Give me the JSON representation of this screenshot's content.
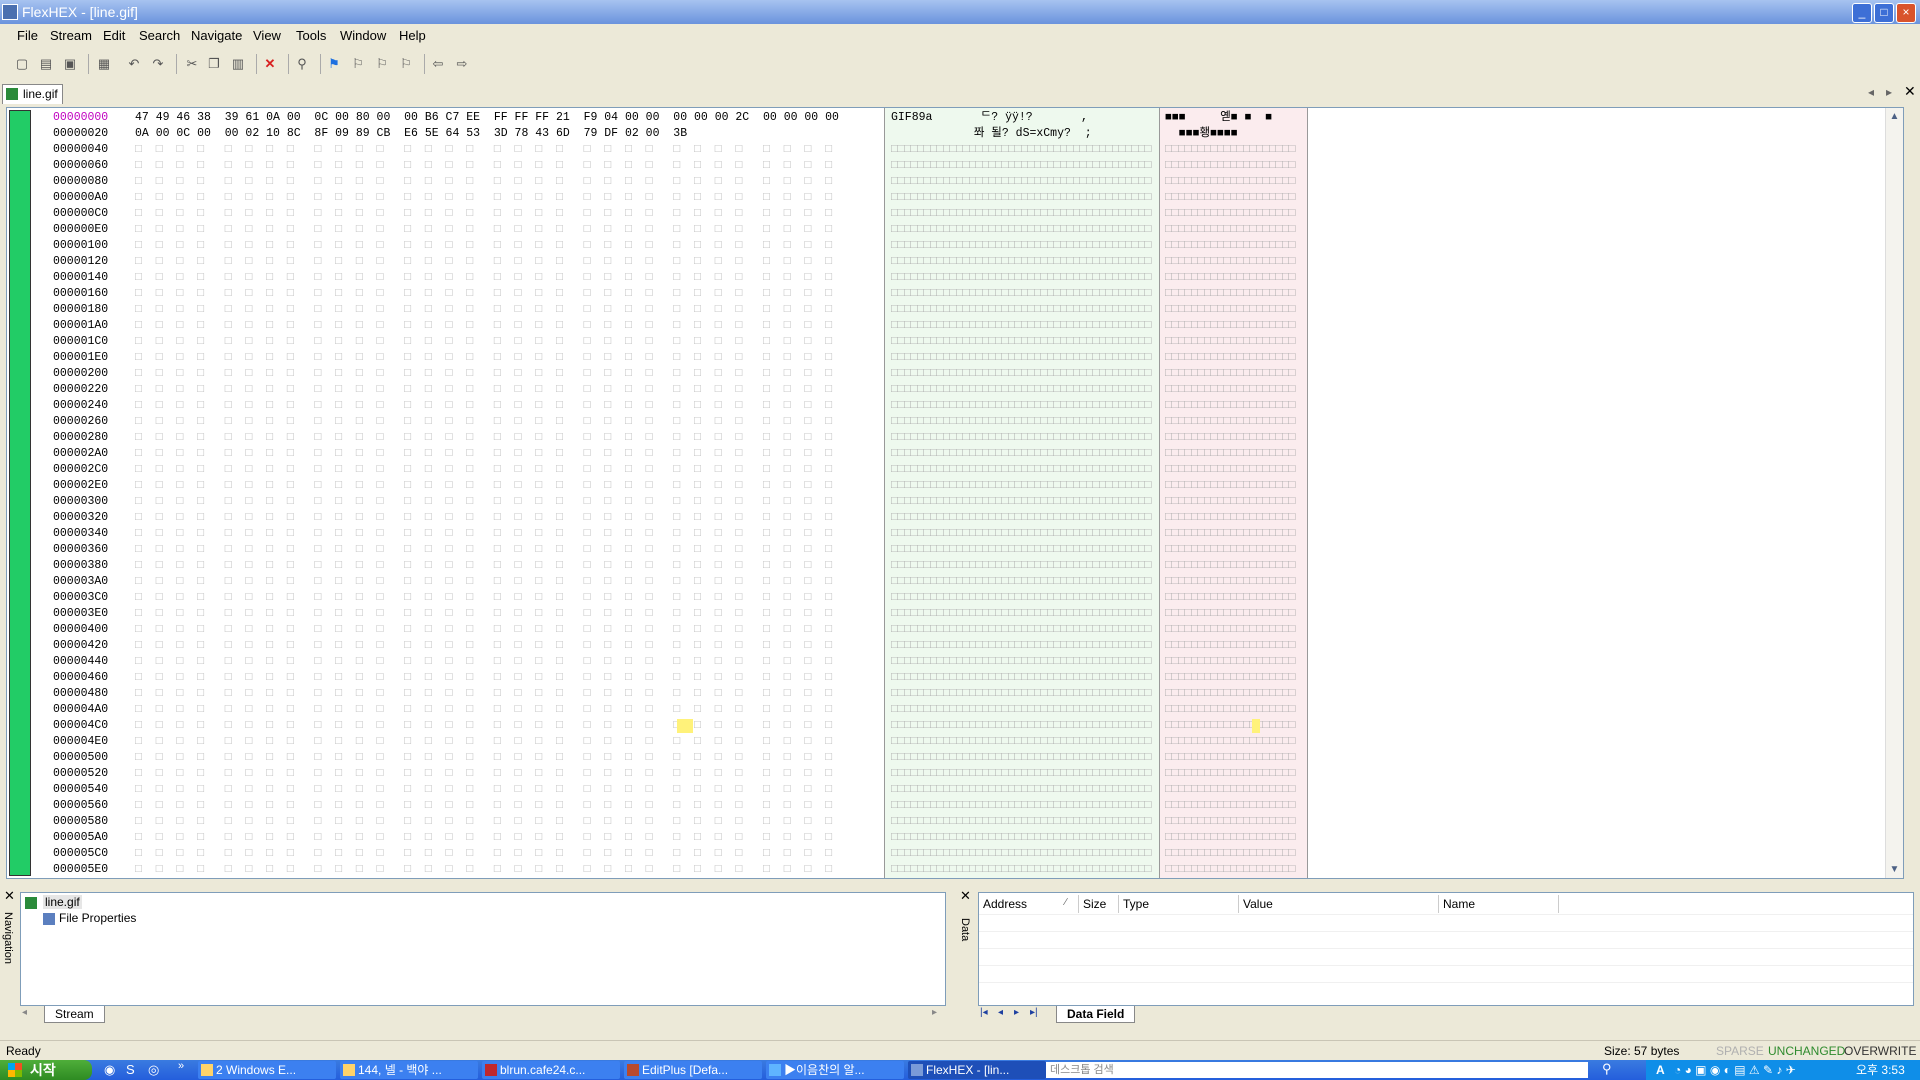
{
  "window": {
    "title": "FlexHEX - [line.gif]",
    "controls": [
      "_",
      "□",
      "×"
    ]
  },
  "menu": [
    "File",
    "Stream",
    "Edit",
    "Search",
    "Navigate",
    "View",
    "Tools",
    "Window",
    "Help"
  ],
  "toolbar": {
    "icons": [
      "new-icon",
      "open-icon",
      "save-icon",
      "print-icon",
      "undo-icon",
      "redo-icon",
      "cut-icon",
      "copy-icon",
      "paste-icon",
      "delete-icon",
      "find-icon",
      "bookmark-icon",
      "bookmark-next-icon",
      "bookmark-prev-icon",
      "bookmark-clear-icon",
      "back-icon",
      "forward-icon"
    ]
  },
  "doc_tab": {
    "label": "line.gif"
  },
  "hex": {
    "rows": [
      {
        "addr": "00000000",
        "hex": "47 49 46 38  39 61 0A 00  0C 00 80 00  00 B6 C7 EE  FF FF FF 21  F9 04 00 00  00 00 00 2C  00 00 00 00",
        "ascii": "GIF89a       ᄃ? ÿÿ!?       ,",
        "p3": "■■■     옏■ ■  ■"
      },
      {
        "addr": "00000020",
        "hex": "0A 00 0C 00  00 02 10 8C  8F 09 89 CB  E6 5E 64 53  3D 78 43 6D  79 DF 02 00  3B",
        "ascii": "            쫘 될? dS=xCmy?  ;",
        "p3": "  ■■■횅■■■■"
      },
      {
        "addr": "00000040"
      },
      {
        "addr": "00000060"
      },
      {
        "addr": "00000080"
      },
      {
        "addr": "000000A0"
      },
      {
        "addr": "000000C0"
      },
      {
        "addr": "000000E0"
      },
      {
        "addr": "00000100"
      },
      {
        "addr": "00000120"
      },
      {
        "addr": "00000140"
      },
      {
        "addr": "00000160"
      },
      {
        "addr": "00000180"
      },
      {
        "addr": "000001A0"
      },
      {
        "addr": "000001C0"
      },
      {
        "addr": "000001E0"
      },
      {
        "addr": "00000200"
      },
      {
        "addr": "00000220"
      },
      {
        "addr": "00000240"
      },
      {
        "addr": "00000260"
      },
      {
        "addr": "00000280"
      },
      {
        "addr": "000002A0"
      },
      {
        "addr": "000002C0"
      },
      {
        "addr": "000002E0"
      },
      {
        "addr": "00000300"
      },
      {
        "addr": "00000320"
      },
      {
        "addr": "00000340"
      },
      {
        "addr": "00000360"
      },
      {
        "addr": "00000380"
      },
      {
        "addr": "000003A0"
      },
      {
        "addr": "000003C0"
      },
      {
        "addr": "000003E0"
      },
      {
        "addr": "00000400"
      },
      {
        "addr": "00000420"
      },
      {
        "addr": "00000440"
      },
      {
        "addr": "00000460"
      },
      {
        "addr": "00000480"
      },
      {
        "addr": "000004A0"
      },
      {
        "addr": "000004C0"
      },
      {
        "addr": "000004E0"
      },
      {
        "addr": "00000500"
      },
      {
        "addr": "00000520"
      },
      {
        "addr": "00000540"
      },
      {
        "addr": "00000560"
      },
      {
        "addr": "00000580"
      },
      {
        "addr": "000005A0"
      },
      {
        "addr": "000005C0"
      },
      {
        "addr": "000005E0"
      }
    ]
  },
  "navigation": {
    "side_label": "Navigation",
    "tree": [
      {
        "label": "line.gif"
      },
      {
        "label": "File Properties"
      }
    ],
    "tab": "Stream"
  },
  "data_panel": {
    "side_label": "Data",
    "columns": [
      "Address",
      "Size",
      "Type",
      "Value",
      "Name"
    ],
    "tab": "Data Field",
    "nav_icons": [
      "first-icon",
      "prev-icon",
      "next-icon",
      "last-icon"
    ]
  },
  "status": {
    "left": "Ready",
    "size": "Size: 57 bytes",
    "sparse": "SPARSE",
    "unchanged": "UNCHANGED",
    "overwrite": "OVERWRITE",
    "colors": {
      "sparse": "#b0b0b0",
      "unchanged": "#2e8b2e",
      "overwrite": "#333333"
    }
  },
  "taskbar": {
    "start": "시작",
    "tasks": [
      "2 Windows E...",
      "144, 넬 - 백야 ...",
      "blrun.cafe24.c...",
      "EditPlus [Defa...",
      "▶이음찬의 알...",
      "FlexHEX - [lin..."
    ],
    "search_placeholder": "데스크톱 검색",
    "clock": "오후 3:53"
  }
}
